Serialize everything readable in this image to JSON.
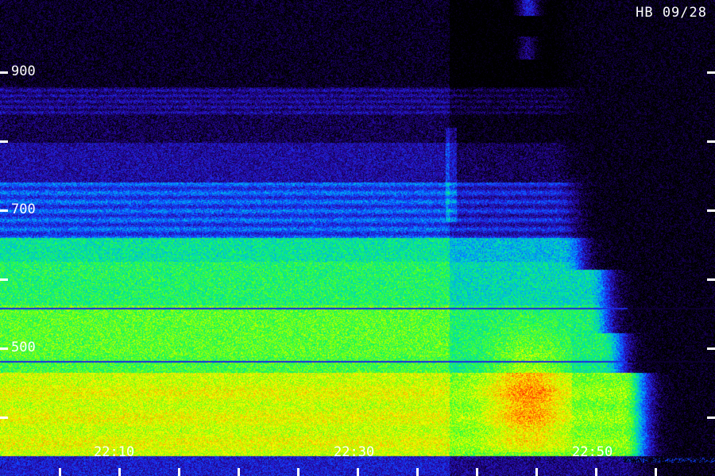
{
  "header": {
    "title": "HB 09/28"
  },
  "y_axis": {
    "labels": [
      "900",
      "700",
      "500"
    ]
  },
  "x_axis": {
    "labels": [
      "22:10",
      "22:30",
      "22:50"
    ]
  },
  "colors": {
    "background": "#000000",
    "colormap": [
      "#000000",
      "#1a0060",
      "#2a10c0",
      "#1040ff",
      "#00a0ff",
      "#00e0b0",
      "#20ff40",
      "#a0ff00",
      "#ffff00",
      "#ff9000",
      "#ff3000"
    ],
    "axis": "#ffffff"
  }
}
